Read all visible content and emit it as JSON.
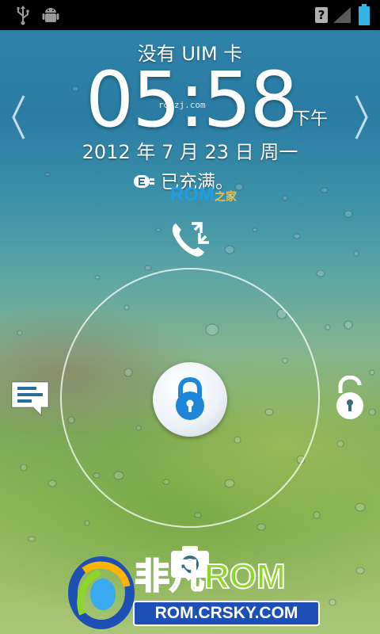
{
  "status_bar": {
    "icons": [
      "usb-icon",
      "android-debug-icon",
      "no-sim-icon",
      "signal-icon",
      "battery-icon"
    ],
    "no_sim_label": "?"
  },
  "lockscreen": {
    "carrier_text": "没有 UIM 卡",
    "time": "05:58",
    "ampm": "下午",
    "date": "2012 年 7 月 23 日 周一",
    "battery_status": "已充满。",
    "charging_icon": "charging-plug-icon"
  },
  "unlock_ring": {
    "center_icon": "lock-icon",
    "targets": [
      {
        "name": "call-rotate-icon",
        "position": "top"
      },
      {
        "name": "message-icon",
        "position": "left"
      },
      {
        "name": "unlock-icon",
        "position": "right"
      },
      {
        "name": "camera-icon",
        "position": "bottom"
      }
    ]
  },
  "watermarks": {
    "small": "romzj.com",
    "rom_main": "ROM",
    "rom_suffix": "之家",
    "brand_cn": "非凡",
    "brand_rom": "ROM",
    "brand_url": "ROM.CRSKY.COM"
  },
  "colors": {
    "accent_blue": "#1e86d8",
    "brand_green": "#8fd62b",
    "brand_blue": "#1e4fb5"
  }
}
